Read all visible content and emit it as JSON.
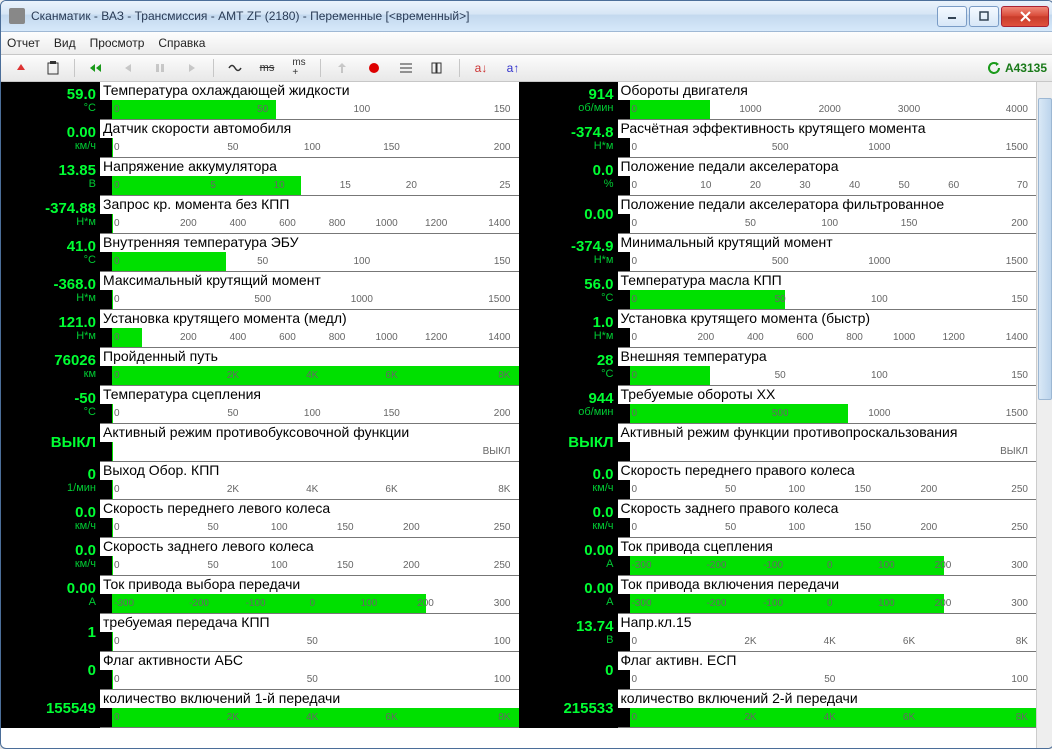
{
  "window": {
    "title": "Сканматик - ВАЗ - Трансмиссия - АМТ ZF (2180) - Переменные [<временный>]"
  },
  "menu": [
    "Отчет",
    "Вид",
    "Просмотр",
    "Справка"
  ],
  "status_code": "A43135",
  "toolbar": {
    "a_down": "a↓",
    "a_up": "a↑",
    "ms": "ms"
  },
  "params": [
    {
      "value": "59.0",
      "unit": "°C",
      "label": "Температура охлаждающей жидкости",
      "fill": 42,
      "ticks": [
        "0",
        "50",
        "100",
        "150"
      ]
    },
    {
      "value": "914",
      "unit": "об/мин",
      "label": "Обороты двигателя",
      "fill": 22,
      "ticks": [
        "0",
        "1000",
        "2000",
        "3000",
        "4000"
      ]
    },
    {
      "value": "0.00",
      "unit": "км/ч",
      "label": "Датчик скорости автомобиля",
      "fill": 3,
      "ticks": [
        "0",
        "50",
        "100",
        "150",
        "200"
      ]
    },
    {
      "value": "-374.8",
      "unit": "Н*м",
      "label": "Расчётная эффективность крутящего момента",
      "fill": 3,
      "ticks": [
        "0",
        "500",
        "1000",
        "1500"
      ]
    },
    {
      "value": "13.85",
      "unit": "В",
      "label": "Напряжение аккумулятора",
      "fill": 48,
      "ticks": [
        "0",
        "5",
        "10",
        "15",
        "20",
        "25"
      ]
    },
    {
      "value": "0.0",
      "unit": "%",
      "label": "Положение педали акселератора",
      "fill": 3,
      "ticks": [
        "0",
        "10",
        "20",
        "30",
        "40",
        "50",
        "60",
        "70"
      ]
    },
    {
      "value": "-374.88",
      "unit": "Н*м",
      "label": "Запрос кр. момента без КПП",
      "fill": 3,
      "ticks": [
        "0",
        "200",
        "400",
        "600",
        "800",
        "1000",
        "1200",
        "1400"
      ]
    },
    {
      "value": "0.00",
      "unit": "",
      "label": "Положение педали акселератора фильтрованное",
      "fill": 3,
      "ticks": [
        "0",
        "50",
        "100",
        "150",
        "200"
      ]
    },
    {
      "value": "41.0",
      "unit": "°C",
      "label": "Внутренняя температура ЭБУ",
      "fill": 30,
      "ticks": [
        "0",
        "50",
        "100",
        "150"
      ]
    },
    {
      "value": "-374.9",
      "unit": "Н*м",
      "label": "Минимальный крутящий момент",
      "fill": 3,
      "ticks": [
        "0",
        "500",
        "1000",
        "1500"
      ]
    },
    {
      "value": "-368.0",
      "unit": "Н*м",
      "label": "Максимальный крутящий момент",
      "fill": 3,
      "ticks": [
        "0",
        "500",
        "1000",
        "1500"
      ]
    },
    {
      "value": "56.0",
      "unit": "°C",
      "label": "Температура масла КПП",
      "fill": 40,
      "ticks": [
        "0",
        "50",
        "100",
        "150"
      ]
    },
    {
      "value": "121.0",
      "unit": "Н*м",
      "label": "Установка крутящего момента (медл)",
      "fill": 10,
      "ticks": [
        "0",
        "200",
        "400",
        "600",
        "800",
        "1000",
        "1200",
        "1400"
      ]
    },
    {
      "value": "1.0",
      "unit": "Н*м",
      "label": "Установка крутящего момента (быстр)",
      "fill": 3,
      "ticks": [
        "0",
        "200",
        "400",
        "600",
        "800",
        "1000",
        "1200",
        "1400"
      ]
    },
    {
      "value": "76026",
      "unit": "км",
      "label": "Пройденный путь",
      "fill": 100,
      "ticks": [
        "0",
        "2K",
        "4K",
        "6K",
        "8K"
      ]
    },
    {
      "value": "28",
      "unit": "°C",
      "label": "Внешняя температура",
      "fill": 22,
      "ticks": [
        "0",
        "50",
        "100",
        "150"
      ]
    },
    {
      "value": "-50",
      "unit": "°C",
      "label": "Температура сцепления",
      "fill": 3,
      "ticks": [
        "0",
        "50",
        "100",
        "150",
        "200"
      ]
    },
    {
      "value": "944",
      "unit": "об/мин",
      "label": "Требуемые обороты ХХ",
      "fill": 55,
      "ticks": [
        "0",
        "500",
        "1000",
        "1500"
      ]
    },
    {
      "value": "ВЫКЛ",
      "unit": "",
      "label": "Активный режим противобуксовочной функции",
      "fill": 3,
      "ticks": [
        "ВЫКЛ"
      ]
    },
    {
      "value": "ВЫКЛ",
      "unit": "",
      "label": "Активный режим функции противопроскальзования",
      "fill": 3,
      "ticks": [
        "ВЫКЛ"
      ]
    },
    {
      "value": "0",
      "unit": "1/мин",
      "label": "Выход Обор. КПП",
      "fill": 3,
      "ticks": [
        "0",
        "2K",
        "4K",
        "6K",
        "8K"
      ]
    },
    {
      "value": "0.0",
      "unit": "км/ч",
      "label": "Скорость переднего правого колеса",
      "fill": 3,
      "ticks": [
        "0",
        "50",
        "100",
        "150",
        "200",
        "250"
      ]
    },
    {
      "value": "0.0",
      "unit": "км/ч",
      "label": "Скорость переднего левого колеса",
      "fill": 3,
      "ticks": [
        "0",
        "50",
        "100",
        "150",
        "200",
        "250"
      ]
    },
    {
      "value": "0.0",
      "unit": "км/ч",
      "label": "Скорость заднего правого колеса",
      "fill": 3,
      "ticks": [
        "0",
        "50",
        "100",
        "150",
        "200",
        "250"
      ]
    },
    {
      "value": "0.0",
      "unit": "км/ч",
      "label": "Скорость заднего левого колеса",
      "fill": 3,
      "ticks": [
        "0",
        "50",
        "100",
        "150",
        "200",
        "250"
      ]
    },
    {
      "value": "0.00",
      "unit": "А",
      "label": "Ток привода сцепления",
      "fill": 78,
      "ticks": [
        "-300",
        "-200",
        "-100",
        "0",
        "100",
        "200",
        "300"
      ]
    },
    {
      "value": "0.00",
      "unit": "А",
      "label": "Ток привода выбора передачи",
      "fill": 78,
      "ticks": [
        "-300",
        "-200",
        "-100",
        "0",
        "100",
        "200",
        "300"
      ]
    },
    {
      "value": "0.00",
      "unit": "А",
      "label": "Ток привода включения передачи",
      "fill": 78,
      "ticks": [
        "-300",
        "-200",
        "-100",
        "0",
        "100",
        "200",
        "300"
      ]
    },
    {
      "value": "1",
      "unit": "",
      "label": "требуемая передача КПП",
      "fill": 3,
      "ticks": [
        "0",
        "50",
        "100"
      ]
    },
    {
      "value": "13.74",
      "unit": "В",
      "label": "Напр.кл.15",
      "fill": 3,
      "ticks": [
        "0",
        "2K",
        "4K",
        "6K",
        "8K"
      ]
    },
    {
      "value": "0",
      "unit": "",
      "label": "Флаг активности АБС",
      "fill": 3,
      "ticks": [
        "0",
        "50",
        "100"
      ]
    },
    {
      "value": "0",
      "unit": "",
      "label": "Флаг активн. ЕСП",
      "fill": 3,
      "ticks": [
        "0",
        "50",
        "100"
      ]
    },
    {
      "value": "155549",
      "unit": "",
      "label": "количество включений 1-й передачи",
      "fill": 100,
      "ticks": [
        "0",
        "2K",
        "4K",
        "6K",
        "8K"
      ]
    },
    {
      "value": "215533",
      "unit": "",
      "label": "количество включений 2-й передачи",
      "fill": 100,
      "ticks": [
        "0",
        "2K",
        "4K",
        "6K",
        "8K"
      ]
    }
  ]
}
